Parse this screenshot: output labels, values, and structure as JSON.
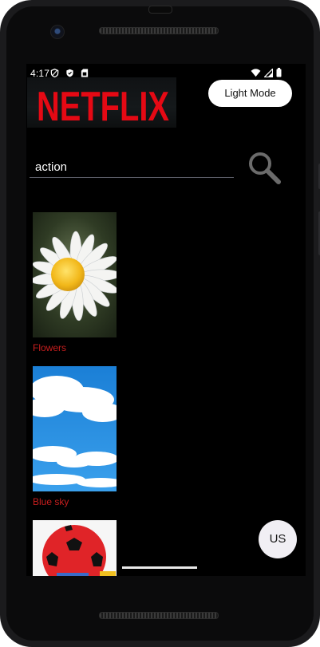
{
  "status_bar": {
    "time": "4:17",
    "icons_left": [
      "privacy-shield-icon",
      "shield-check-icon",
      "sim-card-icon"
    ],
    "icons_right": [
      "wifi-icon",
      "signal-icon",
      "battery-icon"
    ]
  },
  "header": {
    "logo_text": "NETFLIX",
    "logo_color": "#e50914",
    "mode_button_label": "Light Mode"
  },
  "search": {
    "value": "action",
    "icon": "search-icon"
  },
  "movies": [
    {
      "title": "Flowers",
      "image": "daisy-flower"
    },
    {
      "title": "Blue sky",
      "image": "clouds-blue-sky"
    },
    {
      "title": "",
      "image": "red-soccer-ball"
    }
  ],
  "fab": {
    "label": "US"
  },
  "colors": {
    "background": "#000000",
    "accent_red": "#c81e1e",
    "button_bg": "#ffffff"
  }
}
